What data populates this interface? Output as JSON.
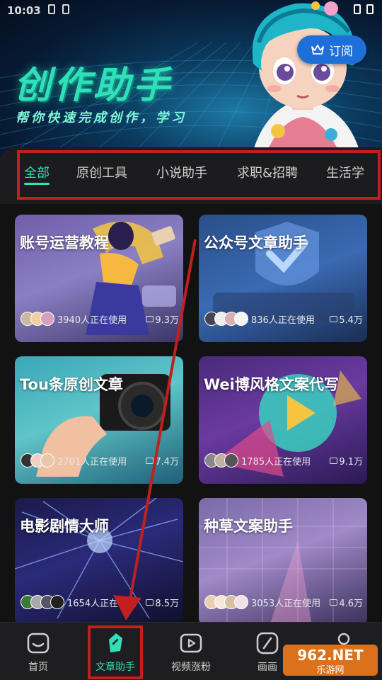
{
  "status_bar": {
    "time": "10:03"
  },
  "hero": {
    "title": "创作助手",
    "subtitle": "帮你快速完成创作，学习",
    "subscribe_label": "订阅",
    "subscribe_icon": "crown-icon"
  },
  "tabs": [
    {
      "label": "全部",
      "active": true
    },
    {
      "label": "原创工具",
      "active": false
    },
    {
      "label": "小说助手",
      "active": false
    },
    {
      "label": "求职&招聘",
      "active": false
    },
    {
      "label": "生活学",
      "active": false
    }
  ],
  "cards": [
    {
      "title": "账号运营教程",
      "users": "3940人正在使用",
      "views": "9.3万"
    },
    {
      "title": "公众号文章助手",
      "users": "836人正在使用",
      "views": "5.4万"
    },
    {
      "title": "Tou条原创文章",
      "users": "2701人正在使用",
      "views": "7.4万"
    },
    {
      "title": "Wei博风格文案代写",
      "users": "1785人正在使用",
      "views": "9.1万"
    },
    {
      "title": "电影剧情大师",
      "users": "1654人正在使用",
      "views": "8.5万"
    },
    {
      "title": "种草文案助手",
      "users": "3053人正在使用",
      "views": "4.6万"
    }
  ],
  "bottom_nav": [
    {
      "label": "首页",
      "icon": "home-icon",
      "active": false
    },
    {
      "label": "文章助手",
      "icon": "pen-nib-icon",
      "active": true
    },
    {
      "label": "视频涨粉",
      "icon": "video-play-icon",
      "active": false
    },
    {
      "label": "画画",
      "icon": "brush-icon",
      "active": false
    },
    {
      "label": "",
      "icon": "profile-icon",
      "active": false
    }
  ],
  "watermark": {
    "text_top": "962.NET",
    "text_bottom": "乐游网"
  },
  "colors": {
    "accent": "#2fe0b8",
    "highlight_box": "#c0201e",
    "subscribe_bg": "#1f6fd8"
  }
}
